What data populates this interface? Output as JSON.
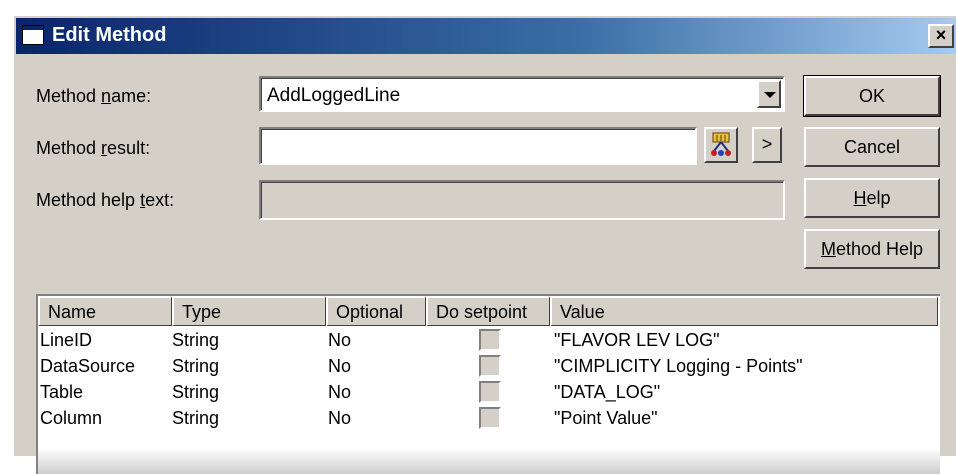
{
  "window": {
    "title": "Edit Method",
    "close_label": "×"
  },
  "fields": {
    "method_name": {
      "label_pre": "Method ",
      "label_key": "n",
      "label_post": "ame:",
      "value": "AddLoggedLine"
    },
    "method_result": {
      "label_pre": "Method ",
      "label_key": "r",
      "label_post": "esult:",
      "value": "",
      "arrow_label": ">"
    },
    "method_help_text": {
      "label_pre": "Method help ",
      "label_key": "t",
      "label_post": "ext:",
      "value": ""
    }
  },
  "buttons": {
    "ok": "OK",
    "cancel": "Cancel",
    "help_key": "H",
    "help_rest": "elp",
    "method_help_key": "M",
    "method_help_rest": "ethod Help"
  },
  "table": {
    "columns": [
      "Name",
      "Type",
      "Optional",
      "Do setpoint",
      "Value"
    ],
    "rows": [
      {
        "name": "LineID",
        "type": "String",
        "optional": "No",
        "do_setpoint": false,
        "value": "\"FLAVOR LEV LOG\""
      },
      {
        "name": "DataSource",
        "type": "String",
        "optional": "No",
        "do_setpoint": false,
        "value": "\"CIMPLICITY Logging - Points\""
      },
      {
        "name": "Table",
        "type": "String",
        "optional": "No",
        "do_setpoint": false,
        "value": "\"DATA_LOG\""
      },
      {
        "name": "Column",
        "type": "String",
        "optional": "No",
        "do_setpoint": false,
        "value": "\"Point Value\""
      }
    ]
  },
  "icons": {
    "title_icon": "window-icon",
    "browse_icon": "point-browser-icon",
    "dropdown_icon": "chevron-down-icon"
  }
}
